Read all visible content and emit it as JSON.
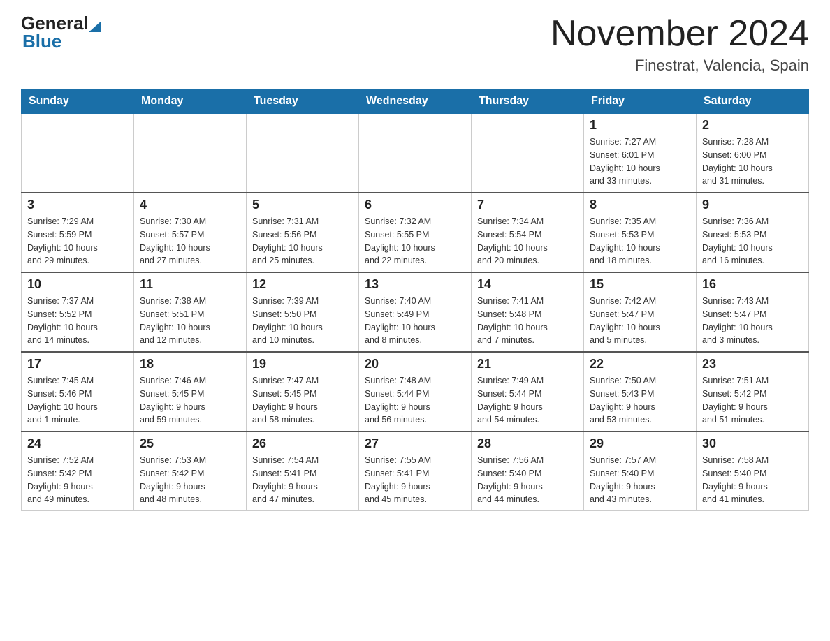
{
  "logo": {
    "general": "General",
    "blue": "Blue",
    "triangle": "▲"
  },
  "title": {
    "month_year": "November 2024",
    "location": "Finestrat, Valencia, Spain"
  },
  "days_of_week": [
    "Sunday",
    "Monday",
    "Tuesday",
    "Wednesday",
    "Thursday",
    "Friday",
    "Saturday"
  ],
  "weeks": [
    [
      {
        "day": "",
        "info": ""
      },
      {
        "day": "",
        "info": ""
      },
      {
        "day": "",
        "info": ""
      },
      {
        "day": "",
        "info": ""
      },
      {
        "day": "",
        "info": ""
      },
      {
        "day": "1",
        "info": "Sunrise: 7:27 AM\nSunset: 6:01 PM\nDaylight: 10 hours\nand 33 minutes."
      },
      {
        "day": "2",
        "info": "Sunrise: 7:28 AM\nSunset: 6:00 PM\nDaylight: 10 hours\nand 31 minutes."
      }
    ],
    [
      {
        "day": "3",
        "info": "Sunrise: 7:29 AM\nSunset: 5:59 PM\nDaylight: 10 hours\nand 29 minutes."
      },
      {
        "day": "4",
        "info": "Sunrise: 7:30 AM\nSunset: 5:57 PM\nDaylight: 10 hours\nand 27 minutes."
      },
      {
        "day": "5",
        "info": "Sunrise: 7:31 AM\nSunset: 5:56 PM\nDaylight: 10 hours\nand 25 minutes."
      },
      {
        "day": "6",
        "info": "Sunrise: 7:32 AM\nSunset: 5:55 PM\nDaylight: 10 hours\nand 22 minutes."
      },
      {
        "day": "7",
        "info": "Sunrise: 7:34 AM\nSunset: 5:54 PM\nDaylight: 10 hours\nand 20 minutes."
      },
      {
        "day": "8",
        "info": "Sunrise: 7:35 AM\nSunset: 5:53 PM\nDaylight: 10 hours\nand 18 minutes."
      },
      {
        "day": "9",
        "info": "Sunrise: 7:36 AM\nSunset: 5:53 PM\nDaylight: 10 hours\nand 16 minutes."
      }
    ],
    [
      {
        "day": "10",
        "info": "Sunrise: 7:37 AM\nSunset: 5:52 PM\nDaylight: 10 hours\nand 14 minutes."
      },
      {
        "day": "11",
        "info": "Sunrise: 7:38 AM\nSunset: 5:51 PM\nDaylight: 10 hours\nand 12 minutes."
      },
      {
        "day": "12",
        "info": "Sunrise: 7:39 AM\nSunset: 5:50 PM\nDaylight: 10 hours\nand 10 minutes."
      },
      {
        "day": "13",
        "info": "Sunrise: 7:40 AM\nSunset: 5:49 PM\nDaylight: 10 hours\nand 8 minutes."
      },
      {
        "day": "14",
        "info": "Sunrise: 7:41 AM\nSunset: 5:48 PM\nDaylight: 10 hours\nand 7 minutes."
      },
      {
        "day": "15",
        "info": "Sunrise: 7:42 AM\nSunset: 5:47 PM\nDaylight: 10 hours\nand 5 minutes."
      },
      {
        "day": "16",
        "info": "Sunrise: 7:43 AM\nSunset: 5:47 PM\nDaylight: 10 hours\nand 3 minutes."
      }
    ],
    [
      {
        "day": "17",
        "info": "Sunrise: 7:45 AM\nSunset: 5:46 PM\nDaylight: 10 hours\nand 1 minute."
      },
      {
        "day": "18",
        "info": "Sunrise: 7:46 AM\nSunset: 5:45 PM\nDaylight: 9 hours\nand 59 minutes."
      },
      {
        "day": "19",
        "info": "Sunrise: 7:47 AM\nSunset: 5:45 PM\nDaylight: 9 hours\nand 58 minutes."
      },
      {
        "day": "20",
        "info": "Sunrise: 7:48 AM\nSunset: 5:44 PM\nDaylight: 9 hours\nand 56 minutes."
      },
      {
        "day": "21",
        "info": "Sunrise: 7:49 AM\nSunset: 5:44 PM\nDaylight: 9 hours\nand 54 minutes."
      },
      {
        "day": "22",
        "info": "Sunrise: 7:50 AM\nSunset: 5:43 PM\nDaylight: 9 hours\nand 53 minutes."
      },
      {
        "day": "23",
        "info": "Sunrise: 7:51 AM\nSunset: 5:42 PM\nDaylight: 9 hours\nand 51 minutes."
      }
    ],
    [
      {
        "day": "24",
        "info": "Sunrise: 7:52 AM\nSunset: 5:42 PM\nDaylight: 9 hours\nand 49 minutes."
      },
      {
        "day": "25",
        "info": "Sunrise: 7:53 AM\nSunset: 5:42 PM\nDaylight: 9 hours\nand 48 minutes."
      },
      {
        "day": "26",
        "info": "Sunrise: 7:54 AM\nSunset: 5:41 PM\nDaylight: 9 hours\nand 47 minutes."
      },
      {
        "day": "27",
        "info": "Sunrise: 7:55 AM\nSunset: 5:41 PM\nDaylight: 9 hours\nand 45 minutes."
      },
      {
        "day": "28",
        "info": "Sunrise: 7:56 AM\nSunset: 5:40 PM\nDaylight: 9 hours\nand 44 minutes."
      },
      {
        "day": "29",
        "info": "Sunrise: 7:57 AM\nSunset: 5:40 PM\nDaylight: 9 hours\nand 43 minutes."
      },
      {
        "day": "30",
        "info": "Sunrise: 7:58 AM\nSunset: 5:40 PM\nDaylight: 9 hours\nand 41 minutes."
      }
    ]
  ]
}
